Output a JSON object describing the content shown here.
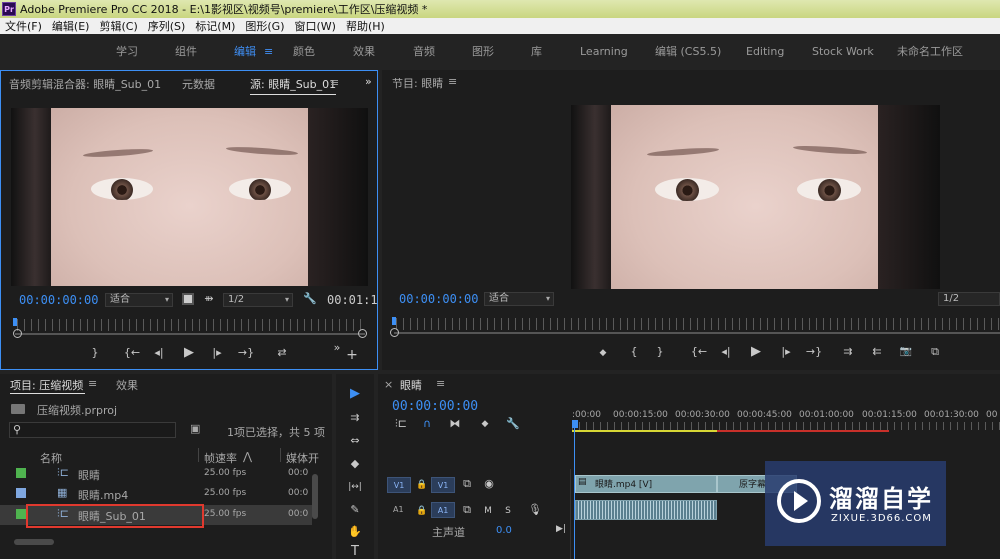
{
  "window": {
    "app_badge": "Pr",
    "title": "Adobe Premiere Pro CC 2018 - E:\\1影视区\\视频号\\premiere\\工作区\\压缩视频 *"
  },
  "menu": [
    "文件(F)",
    "编辑(E)",
    "剪辑(C)",
    "序列(S)",
    "标记(M)",
    "图形(G)",
    "窗口(W)",
    "帮助(H)"
  ],
  "workspaces": [
    "学习",
    "组件",
    "编辑",
    "颜色",
    "效果",
    "音频",
    "图形",
    "库",
    "Learning",
    "编辑 (CS5.5)",
    "Editing",
    "Stock Work",
    "未命名工作区"
  ],
  "workspace_menu_icon": "≡",
  "source_panel": {
    "tabs": [
      "音频剪辑混合器: 眼睛_Sub_01",
      "元数据",
      "源: 眼睛_Sub_01"
    ],
    "tab_menu": "≡",
    "expand": "»",
    "timecode": "00:00:00:00",
    "fit": "适合",
    "resolution": "1/2",
    "duration": "00:01:1",
    "buttons": [
      "}",
      "{←",
      "◂|",
      "▶",
      "|▸",
      "→}",
      "⇄"
    ],
    "more": "»",
    "add": "+"
  },
  "program_panel": {
    "tab": "节目: 眼睛",
    "tab_menu": "≡",
    "timecode": "00:00:00:00",
    "fit": "适合",
    "resolution": "1/2",
    "buttons": [
      "◆",
      "{",
      "}",
      "{←",
      "◂|",
      "▶",
      "|▸",
      "→}",
      "⇉",
      "⇇",
      "📷",
      "⧉"
    ]
  },
  "project_panel": {
    "tabs": [
      "项目: 压缩视频",
      "效果"
    ],
    "tab_menu": "≡",
    "file": "压缩视频.prproj",
    "selection_info": "1项已选择，共 5 项",
    "columns": [
      "名称",
      "帧速率",
      "媒体开"
    ],
    "sort_icon": "⋀",
    "rows": [
      {
        "name": "眼睛",
        "fps": "25.00 fps",
        "start": "00:0",
        "color": "#4fb34f"
      },
      {
        "name": "眼睛.mp4",
        "fps": "25.00 fps",
        "start": "00:0",
        "color": "#7fa7e0"
      },
      {
        "name": "眼睛_Sub_01",
        "fps": "25.00 fps",
        "start": "00:0",
        "color": "#4fb34f"
      }
    ]
  },
  "tools": [
    "▶",
    "⇉",
    "⇔",
    "◆",
    "|↔|",
    "✎",
    "✋",
    "T"
  ],
  "timeline": {
    "close": "×",
    "tab": "眼睛",
    "tab_menu": "≡",
    "timecode": "00:00:00:00",
    "ruler_labels": [
      ":00:00",
      "00:00:15:00",
      "00:00:30:00",
      "00:00:45:00",
      "00:01:00:00",
      "00:01:15:00",
      "00:01:30:00",
      "00"
    ],
    "tracks": {
      "v1_left": "V1",
      "v1_right": "V1",
      "a1_left": "A1",
      "a1_right": "A1",
      "mute": "M",
      "solo": "S",
      "master_label": "主声道",
      "master_value": "0.0"
    },
    "clips": {
      "video1": "眼睛.mp4 [V]",
      "video2": "原字幕"
    }
  },
  "watermark": {
    "brand": "溜溜自学",
    "url": "ZIXUE.3D66.COM"
  },
  "colors": {
    "accent": "#3d8ff4",
    "work_area_yellow": "#d7d735",
    "render_red": "#c8302a",
    "selection_red": "#e0392e"
  }
}
